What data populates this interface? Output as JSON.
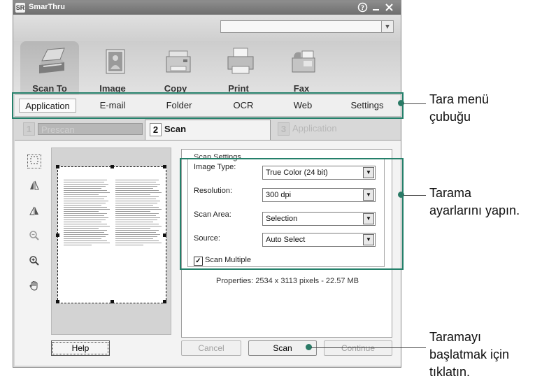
{
  "window": {
    "title": "SmarThru",
    "logo_text": "SR",
    "help_icon": "help-icon",
    "minimize_icon": "minimize-icon",
    "close_icon": "close-icon",
    "top_select_value": ""
  },
  "toolbar": {
    "items": [
      {
        "label": "Scan To",
        "icon": "scanner-icon",
        "active": true
      },
      {
        "label": "Image",
        "icon": "image-icon",
        "active": false
      },
      {
        "label": "Copy",
        "icon": "copier-icon",
        "active": false
      },
      {
        "label": "Print",
        "icon": "printer-icon",
        "active": false
      },
      {
        "label": "Fax",
        "icon": "fax-icon",
        "active": false
      }
    ]
  },
  "menu": {
    "items": [
      "Application",
      "E-mail",
      "Folder",
      "OCR",
      "Web",
      "Settings"
    ],
    "selected": "Application"
  },
  "steps": [
    {
      "number": "1",
      "label": "Prescan",
      "state": "disabled"
    },
    {
      "number": "2",
      "label": "Scan",
      "state": "active"
    },
    {
      "number": "3",
      "label": "Application",
      "state": "disabled"
    }
  ],
  "side_tools": [
    "marquee-select-icon",
    "flip-horizontal-icon",
    "flip-vertical-icon",
    "zoom-out-icon",
    "zoom-in-icon",
    "hand-pan-icon"
  ],
  "settings": {
    "legend": "Scan Settings",
    "fields": [
      {
        "label": "Image Type:",
        "value": "True Color (24 bit)"
      },
      {
        "label": "Resolution:",
        "value": "300 dpi"
      },
      {
        "label": "Scan Area:",
        "value": "Selection"
      },
      {
        "label": "Source:",
        "value": "Auto Select"
      }
    ],
    "scan_multiple": {
      "label": "Scan Multiple",
      "checked": true
    },
    "properties": "Properties: 2534 x 3113 pixels - 22.57 MB"
  },
  "buttons": {
    "help": "Help",
    "cancel": "Cancel",
    "scan": "Scan",
    "continue": "Continue"
  },
  "annotations": {
    "menu_bar": {
      "line1": "Tara menü",
      "line2": "çubuğu"
    },
    "settings": {
      "line1": "Tarama",
      "line2": "ayarlarını yapın."
    },
    "scan": {
      "line1": "Taramayı",
      "line2": "başlatmak için",
      "line3": "tıklatın."
    },
    "highlight_color": "#24806a"
  }
}
